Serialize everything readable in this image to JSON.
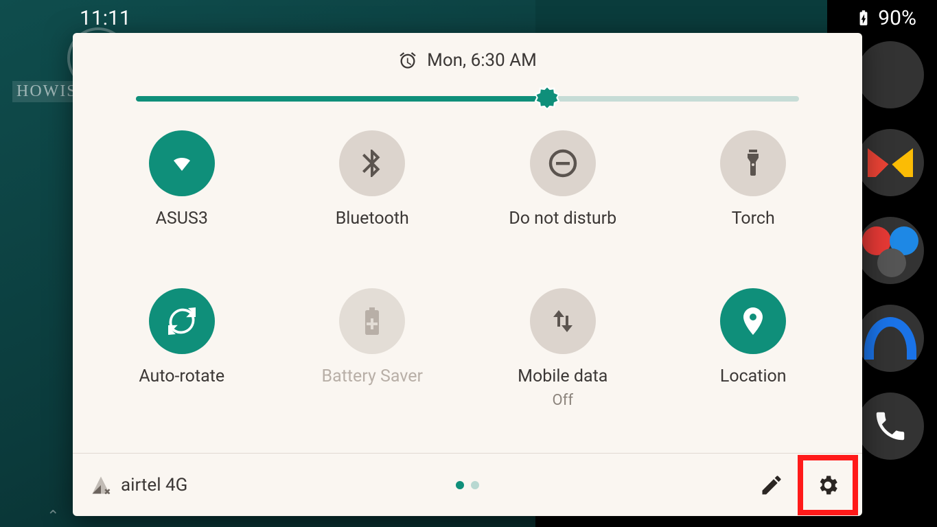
{
  "status_bar": {
    "time": "11:11",
    "battery_percent": "90%"
  },
  "watermark": {
    "text": "HOWISOLVE.COM"
  },
  "panel": {
    "alarm_label": "Mon, 6:30 AM",
    "brightness_percent": 62,
    "tiles": [
      {
        "key": "wifi",
        "label": "ASUS3",
        "state": "on",
        "icon": "wifi"
      },
      {
        "key": "bluetooth",
        "label": "Bluetooth",
        "state": "off",
        "icon": "bluetooth"
      },
      {
        "key": "dnd",
        "label": "Do not disturb",
        "state": "off",
        "icon": "dnd"
      },
      {
        "key": "torch",
        "label": "Torch",
        "state": "off",
        "icon": "torch"
      },
      {
        "key": "autorotate",
        "label": "Auto-rotate",
        "state": "on",
        "icon": "rotate"
      },
      {
        "key": "batterysaver",
        "label": "Battery Saver",
        "state": "disabled",
        "icon": "battery"
      },
      {
        "key": "mobiledata",
        "label": "Mobile data",
        "sub": "Off",
        "state": "off",
        "icon": "data"
      },
      {
        "key": "location",
        "label": "Location",
        "state": "on",
        "icon": "location"
      }
    ],
    "carrier": "airtel 4G",
    "page_count": 2,
    "page_active": 0
  },
  "dock": {
    "apps": [
      "chrome",
      "gmail",
      "app-folder",
      "launcher",
      "phone"
    ]
  },
  "highlight_target": "settings-button"
}
